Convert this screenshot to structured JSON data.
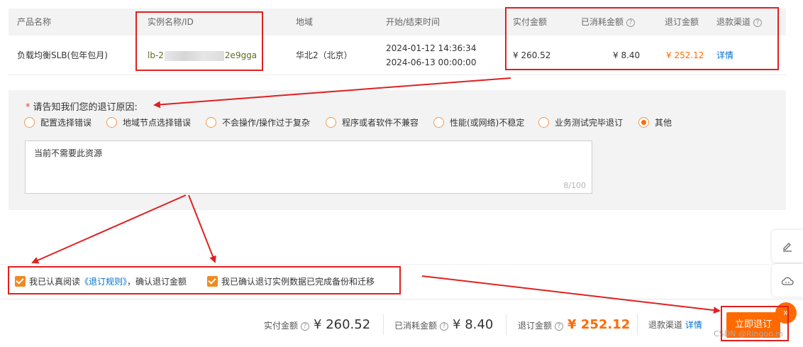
{
  "table": {
    "headers": {
      "product": "产品名称",
      "instance": "实例名称/ID",
      "region": "地域",
      "time": "开始/结束时间",
      "paid": "实付金额",
      "consumed": "已消耗金额",
      "refund": "退订金额",
      "channel": "退款渠道"
    },
    "row": {
      "product": "负载均衡SLB(包年包月)",
      "instance_prefix": "lb-2",
      "instance_suffix": "2e9gga",
      "region": "华北2（北京）",
      "start": "2024-01-12 14:36:34",
      "end": "2024-06-13 00:00:00",
      "paid": "¥ 260.52",
      "consumed": "¥ 8.40",
      "refund": "¥ 252.12",
      "channel_link": "详情"
    }
  },
  "reason": {
    "title": "请告知我们您的退订原因:",
    "required_mark": "*",
    "options": [
      "配置选择错误",
      "地域节点选择错误",
      "不会操作/操作过于复杂",
      "程序或者软件不兼容",
      "性能(或网络)不稳定",
      "业务测试完毕退订",
      "其他"
    ],
    "selected": "其他",
    "text": "当前不需要此资源",
    "counter": "8/100"
  },
  "checks": {
    "c1_before": "我已认真阅读",
    "c1_link": "《退订规则》",
    "c1_after": "，确认退订金额",
    "c2": "我已确认退订实例数据已完成备份和迁移"
  },
  "footer": {
    "paid_label": "实付金额",
    "paid_value": "¥ 260.52",
    "consumed_label": "已消耗金额",
    "consumed_value": "¥ 8.40",
    "refund_label": "退订金额",
    "refund_value": "¥ 252.12",
    "channel_label": "退款渠道",
    "channel_link": "详情",
    "submit": "立即退订"
  },
  "side": {
    "edit_icon": "edit-icon",
    "cloud_icon": "cloud-icon",
    "expand_glyph": "»"
  },
  "watermark": "CSDN @Ringoo.m",
  "colors": {
    "accent": "#ff6a00",
    "link": "#0070cc",
    "annotation": "#e02020"
  }
}
